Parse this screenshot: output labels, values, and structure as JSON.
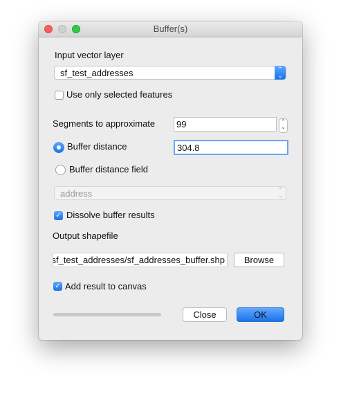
{
  "window": {
    "title": "Buffer(s)"
  },
  "input_layer": {
    "label": "Input vector layer",
    "value": "sf_test_addresses"
  },
  "use_selected": {
    "label": "Use only selected features",
    "checked": false
  },
  "segments": {
    "label": "Segments to approximate",
    "value": "99"
  },
  "buffer_distance": {
    "label": "Buffer distance",
    "value": "304.8",
    "selected": true
  },
  "buffer_field": {
    "label": "Buffer distance field",
    "selected": false,
    "value": "address"
  },
  "dissolve": {
    "label": "Dissolve buffer results",
    "checked": true
  },
  "output": {
    "label": "Output shapefile",
    "value": "sf_test_addresses/sf_addresses_buffer.shp",
    "browse_label": "Browse"
  },
  "add_canvas": {
    "label": "Add result to canvas",
    "checked": true
  },
  "progress": {
    "percent": 0
  },
  "buttons": {
    "close": "Close",
    "ok": "OK"
  },
  "colors": {
    "accent": "#1a72e8"
  }
}
